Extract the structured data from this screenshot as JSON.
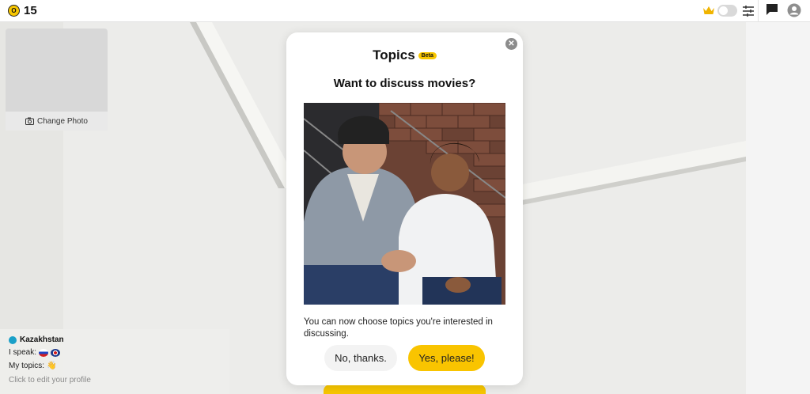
{
  "header": {
    "coin_count": "15",
    "coin_symbol": "O",
    "accent_color": "#f7c600",
    "icons": [
      "coin-icon",
      "crown-icon",
      "toggle-switch",
      "filters-icon",
      "chat-icon",
      "profile-icon"
    ]
  },
  "self_view": {
    "change_photo_label": "Change Photo"
  },
  "profile": {
    "country": "Kazakhstan",
    "speak_label": "I speak:",
    "topics_label": "My topics:",
    "topics_emoji": "👋",
    "edit_hint": "Click to edit your profile"
  },
  "modal": {
    "title": "Topics",
    "badge": "Beta",
    "question": "Want to discuss movies?",
    "description": "You can now choose topics you're interested in discussing.",
    "decline_label": "No, thanks.",
    "accept_label": "Yes, please!",
    "close_symbol": "✕"
  }
}
